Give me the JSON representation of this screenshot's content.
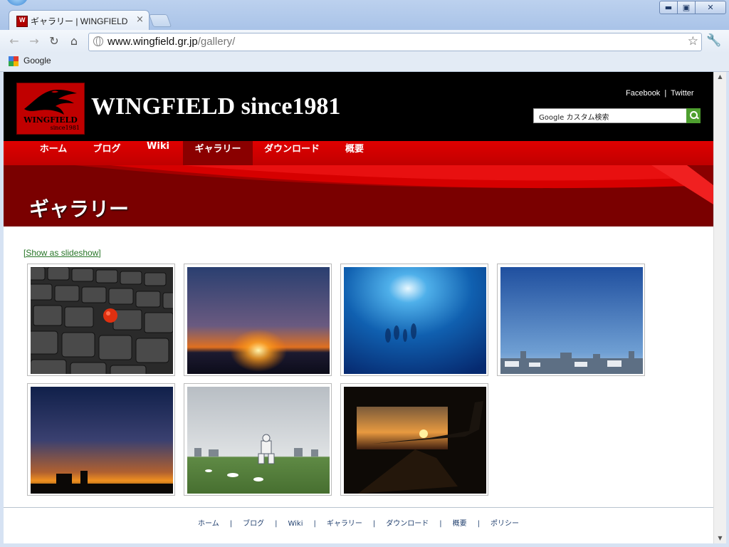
{
  "browser": {
    "tab_title": "ギャラリー | WINGFIELD",
    "tab_close": "×",
    "url_host": "www.wingfield.gr.jp",
    "url_path": "/gallery/",
    "window_buttons": {
      "minimize": "▬",
      "maximize": "▣",
      "close": "✕"
    },
    "bookmarks": [
      {
        "label": "Google"
      }
    ]
  },
  "site": {
    "logo_text": "WINGFIELD",
    "logo_since": "since1981",
    "title": "WINGFIELD since1981",
    "social": {
      "facebook": "Facebook",
      "separator": "|",
      "twitter": "Twitter"
    },
    "search_placeholder": "Google カスタム検索",
    "nav": [
      {
        "label": "ホーム",
        "active": false
      },
      {
        "label": "ブログ",
        "active": false
      },
      {
        "label": "Wiki",
        "active": false
      },
      {
        "label": "ギャラリー",
        "active": true
      },
      {
        "label": "ダウンロード",
        "active": false
      },
      {
        "label": "概要",
        "active": false
      }
    ],
    "banner_title": "ギャラリー"
  },
  "gallery": {
    "slideshow_link": "[Show as slideshow]",
    "images": [
      {
        "subject": "keyboard-trackpoint"
      },
      {
        "subject": "sunset-horizon"
      },
      {
        "subject": "underwater-divers"
      },
      {
        "subject": "city-skyline-blue-sky"
      },
      {
        "subject": "sunset-silhouette-buildings"
      },
      {
        "subject": "gundam-statue-park"
      },
      {
        "subject": "hangar-airplane-sunset"
      }
    ]
  },
  "footer": {
    "links": [
      "ホーム",
      "ブログ",
      "Wiki",
      "ギャラリー",
      "ダウンロード",
      "概要",
      "ポリシー"
    ],
    "separator": "|"
  },
  "colors": {
    "brand_red": "#c00000",
    "nav_active": "#8a0000",
    "header_bg": "#000000",
    "link_green": "#277527"
  }
}
